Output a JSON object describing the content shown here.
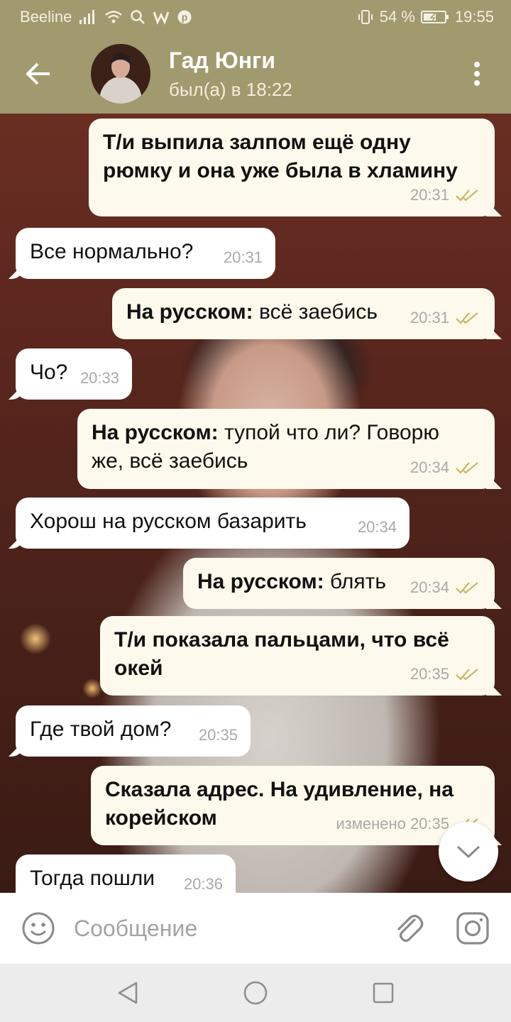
{
  "status_bar": {
    "carrier": "Beeline",
    "battery": "54 %",
    "time": "19:55"
  },
  "header": {
    "contact_name": "Гад Юнги",
    "contact_status": "был(а) в 18:22"
  },
  "messages": [
    {
      "dir": "out",
      "text": "Т/и выпила залпом ещё одну рюмку и она уже была в хламину",
      "bold_all": true,
      "time": "20:31",
      "read": true
    },
    {
      "dir": "in",
      "text": "Все нормально?",
      "time": "20:31"
    },
    {
      "dir": "out",
      "prefix": "На русском:",
      "text": " всё заебись",
      "time": "20:31",
      "read": true
    },
    {
      "dir": "in",
      "text": "Чо?",
      "time": "20:33"
    },
    {
      "dir": "out",
      "prefix": "На русском:",
      "text": " тупой что ли? Говорю же, всё заебись",
      "time": "20:34",
      "read": true
    },
    {
      "dir": "in",
      "text": "Хорош на русском базарить",
      "time": "20:34"
    },
    {
      "dir": "out",
      "prefix": "На русском:",
      "text": " блять",
      "time": "20:34",
      "read": true
    },
    {
      "dir": "out",
      "text": "Т/и показала пальцами, что всё окей",
      "bold_all": true,
      "time": "20:35",
      "read": true
    },
    {
      "dir": "in",
      "text": "Где твой дом?",
      "time": "20:35"
    },
    {
      "dir": "out",
      "text": "Сказала адрес. На удивление, на корейском",
      "bold_all": true,
      "time": "изменено 20:35",
      "read": true
    },
    {
      "dir": "in",
      "text": "Тогда пошли",
      "time": "20:36"
    }
  ],
  "input": {
    "placeholder": "Сообщение"
  },
  "icons": {
    "back": "arrow-left-icon",
    "menu": "more-vertical-icon",
    "emoji": "smile-icon",
    "attach": "paperclip-icon",
    "camera": "camera-icon",
    "scroll": "chevron-down-icon",
    "read": "double-check-icon"
  },
  "colors": {
    "header": "#a19a6e",
    "incoming_bubble": "#ffffff",
    "outgoing_bubble": "#fdf9ec",
    "read_check": "#c9b86a"
  }
}
